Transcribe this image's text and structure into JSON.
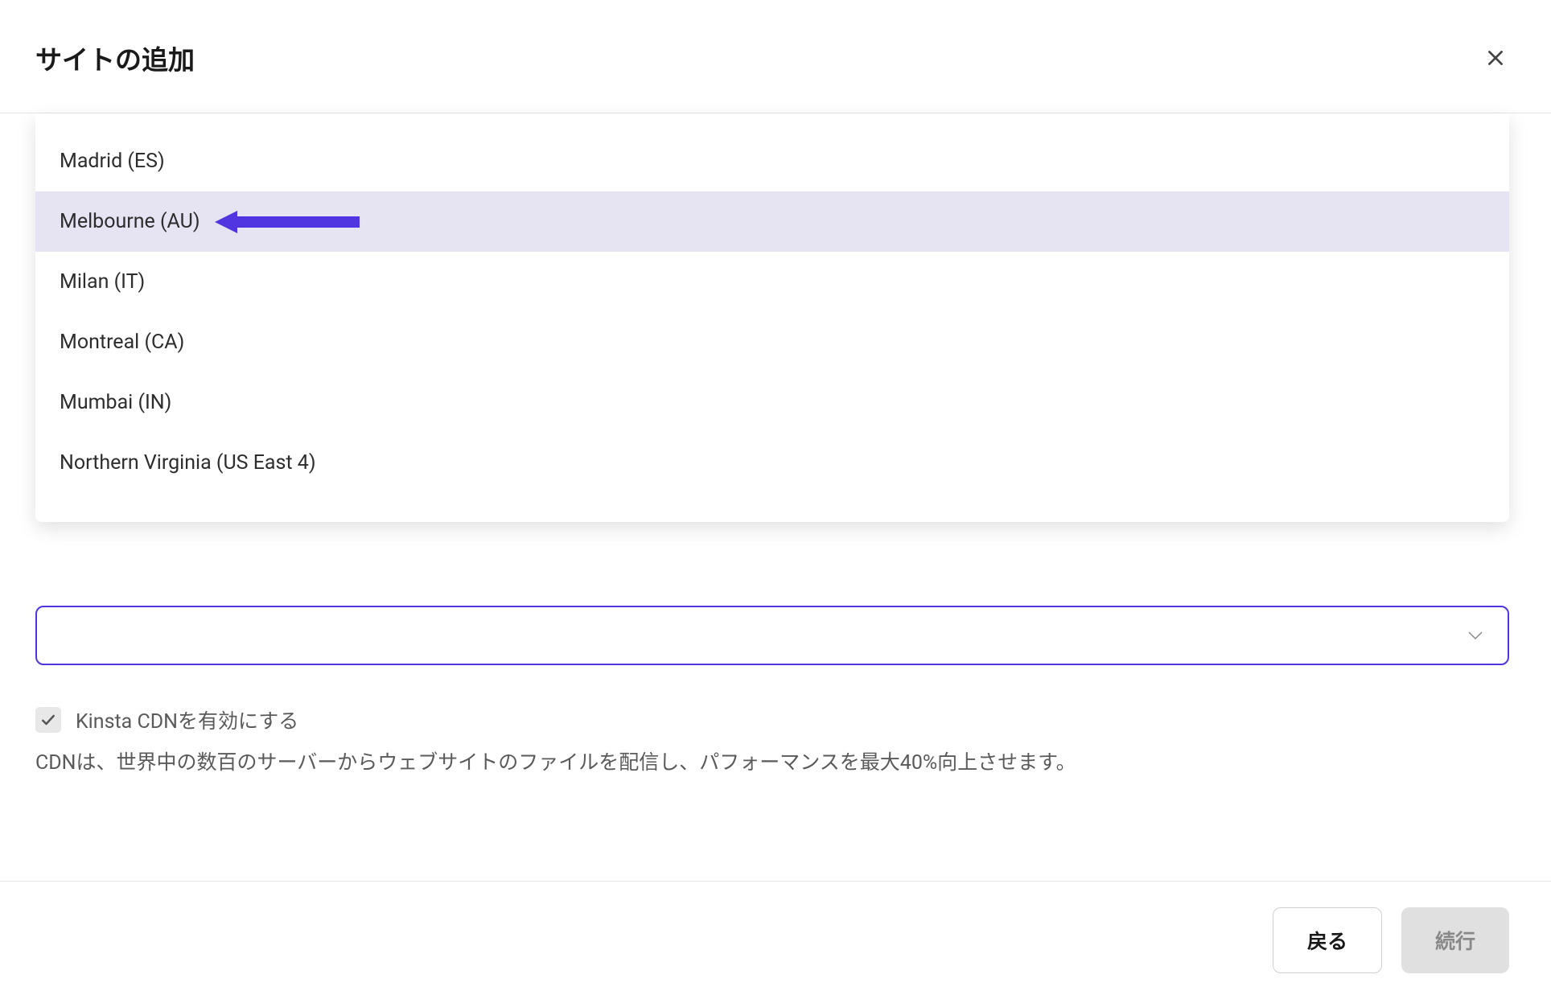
{
  "header": {
    "title": "サイトの追加"
  },
  "dropdown": {
    "items": [
      {
        "label": "Madrid (ES)",
        "highlighted": false
      },
      {
        "label": "Melbourne (AU)",
        "highlighted": true
      },
      {
        "label": "Milan (IT)",
        "highlighted": false
      },
      {
        "label": "Montreal (CA)",
        "highlighted": false
      },
      {
        "label": "Mumbai (IN)",
        "highlighted": false
      },
      {
        "label": "Northern Virginia (US East 4)",
        "highlighted": false
      }
    ]
  },
  "cdn": {
    "label": "Kinsta CDNを有効にする",
    "description": "CDNは、世界中の数百のサーバーからウェブサイトのファイルを配信し、パフォーマンスを最大40%向上させます。"
  },
  "footer": {
    "back": "戻る",
    "continue": "続行"
  },
  "colors": {
    "accent": "#5035e0",
    "highlight_bg": "#e6e4f2"
  }
}
